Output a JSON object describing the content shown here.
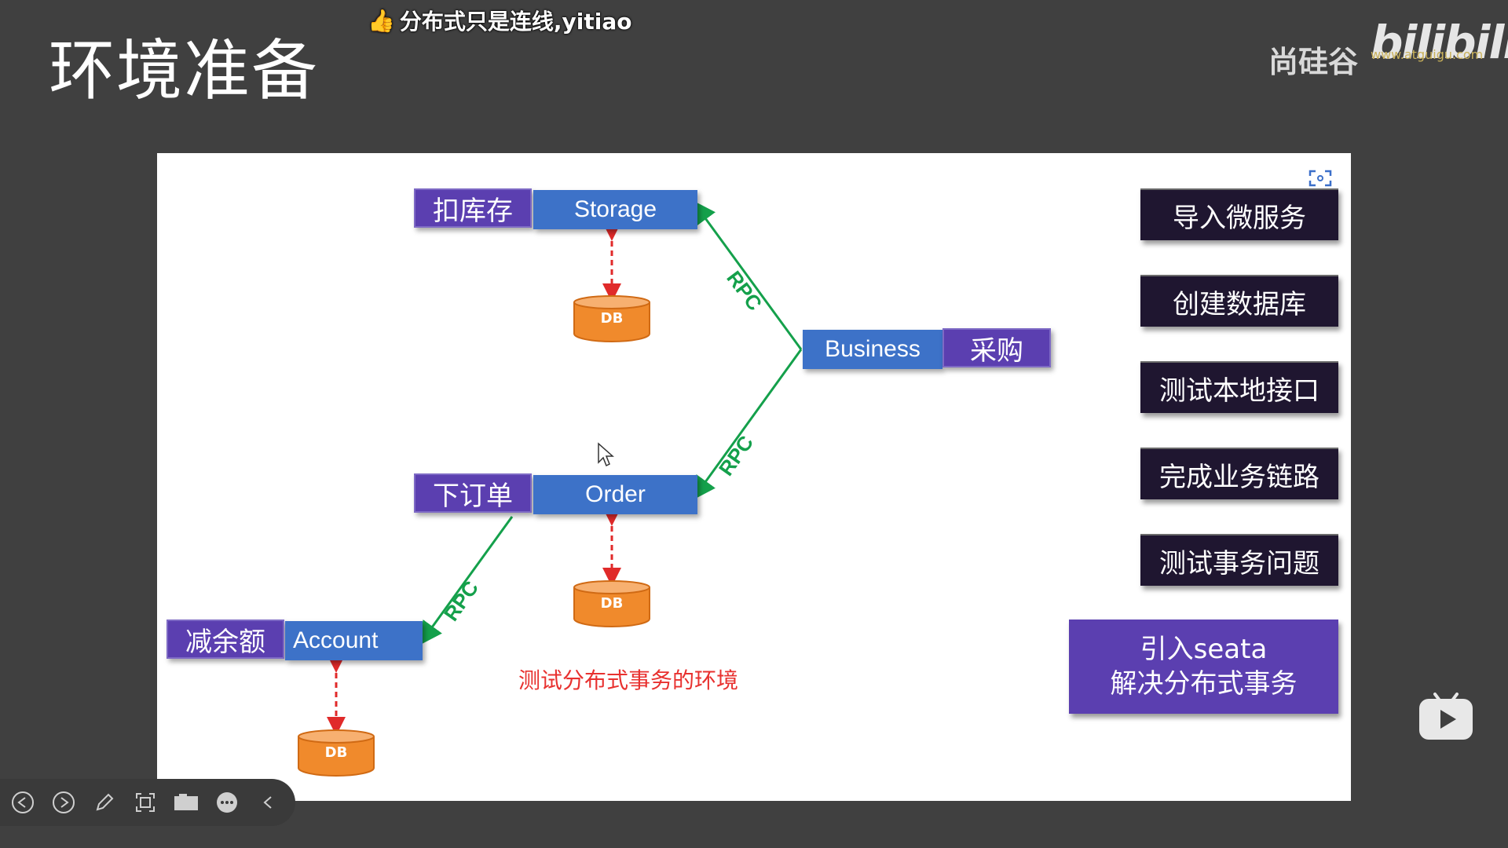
{
  "page": {
    "title": "环境准备"
  },
  "danmaku": {
    "text": "分布式只是连线,yitiao"
  },
  "logo": {
    "cn_name": "尚硅谷",
    "brand": "bilibili",
    "url": "www.atguigu.com"
  },
  "diagram": {
    "services": {
      "storage": {
        "name": "Storage",
        "action": "扣库存"
      },
      "order": {
        "name": "Order",
        "action": "下订单"
      },
      "account": {
        "name": "Account",
        "action": "减余额"
      },
      "business": {
        "name": "Business",
        "action": "采购"
      }
    },
    "db_label": "DB",
    "rpc_label": "RPC",
    "caption": "测试分布式事务的环境"
  },
  "steps": [
    {
      "label": "导入微服务"
    },
    {
      "label": "创建数据库"
    },
    {
      "label": "测试本地接口"
    },
    {
      "label": "完成业务链路"
    },
    {
      "label": "测试事务问题"
    }
  ],
  "seata_box": {
    "line1": "引入seata",
    "line2": "解决分布式事务"
  },
  "colors": {
    "service_blue": "#3d72c8",
    "action_purple": "#5b3fb0",
    "rpc_green": "#14a04b",
    "db_orange": "#f08a2c",
    "caption_red": "#e8312f",
    "step_dark": "#1f1630"
  },
  "toolbar": {
    "icons": [
      "prev-icon",
      "next-icon",
      "pen-icon",
      "screenshot-icon",
      "camera-icon",
      "more-icon",
      "collapse-icon"
    ]
  }
}
